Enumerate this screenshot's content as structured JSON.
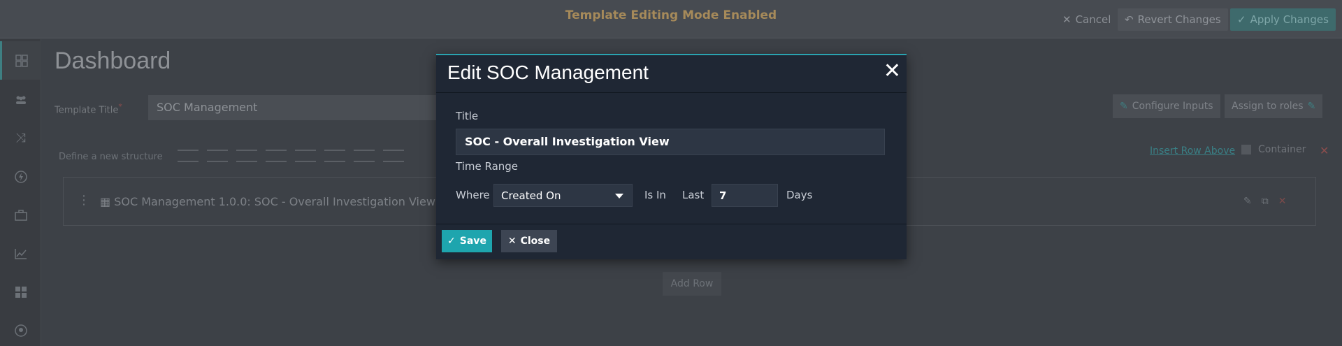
{
  "topbar": {
    "mode_text": "Template Editing Mode Enabled",
    "cancel_label": "Cancel",
    "revert_label": "Revert Changes",
    "apply_label": "Apply Changes"
  },
  "sidebar": {
    "items": [
      {
        "icon": "dashboard-icon",
        "active": true
      },
      {
        "icon": "users-icon",
        "active": false
      },
      {
        "icon": "shuffle-icon",
        "active": false
      },
      {
        "icon": "bolt-icon",
        "active": false
      },
      {
        "icon": "briefcase-icon",
        "active": false
      },
      {
        "icon": "chart-icon",
        "active": false
      },
      {
        "icon": "widgets-icon",
        "active": false
      },
      {
        "icon": "settings-icon",
        "active": false
      }
    ]
  },
  "page": {
    "title": "Dashboard",
    "template_title_label": "Template Title",
    "template_title_value": "SOC Management",
    "configure_inputs_label": "Configure Inputs",
    "assign_roles_label": "Assign to roles",
    "structure_label": "Define a new structure",
    "insert_row_above": "Insert Row Above",
    "container_label": "Container",
    "widget_title": "SOC Management 1.0.0: SOC - Overall Investigation View",
    "add_row_label": "Add Row"
  },
  "modal": {
    "title": "Edit SOC Management",
    "title_label": "Title",
    "title_value": "SOC - Overall Investigation View",
    "time_range_label": "Time Range",
    "where_label": "Where",
    "field_selected": "Created On",
    "is_in_label": "Is In",
    "last_label": "Last",
    "last_value": "7",
    "days_label": "Days",
    "save_label": "Save",
    "close_label": "Close"
  },
  "colors": {
    "accent": "#1ea5ae",
    "modal_bg": "#1f2734",
    "warning_text": "#a68a5a"
  }
}
